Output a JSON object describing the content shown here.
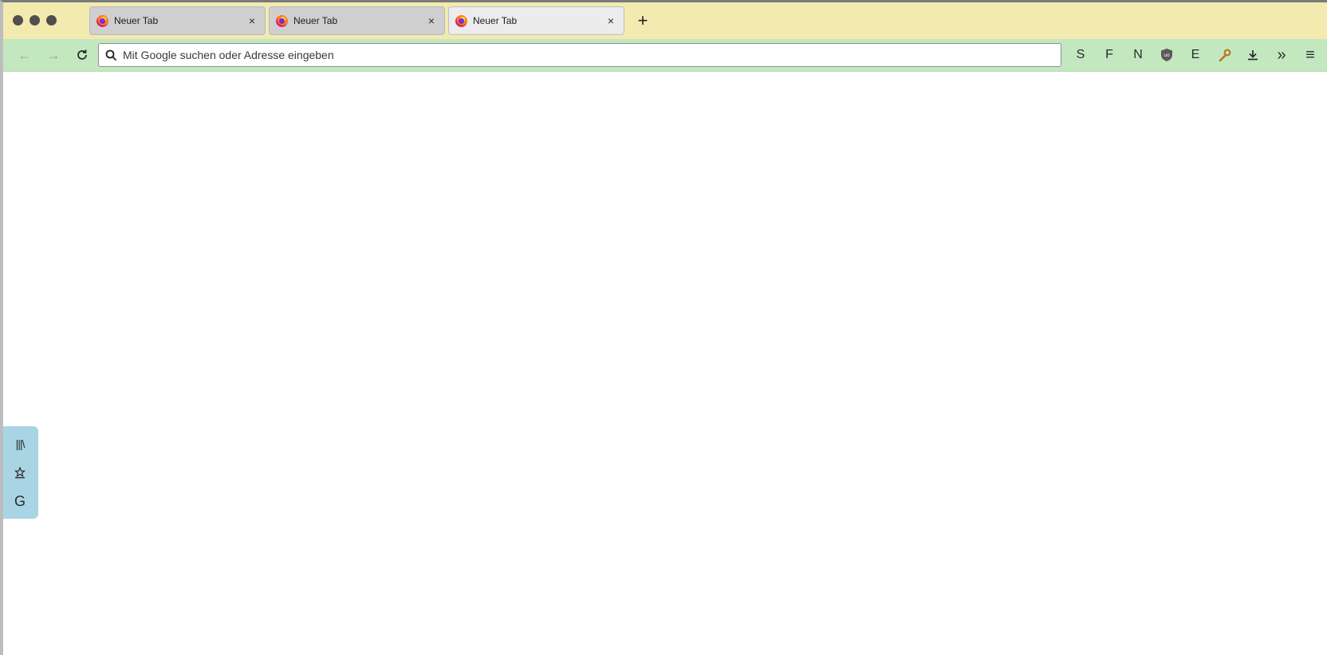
{
  "tabs": [
    {
      "label": "Neuer Tab",
      "close": "×",
      "active": false
    },
    {
      "label": "Neuer Tab",
      "close": "×",
      "active": false
    },
    {
      "label": "Neuer Tab",
      "close": "×",
      "active": true
    }
  ],
  "new_tab_symbol": "+",
  "urlbar": {
    "placeholder": "Mit Google suchen oder Adresse eingeben",
    "value": ""
  },
  "toolbar": {
    "back_symbol": "←",
    "forward_symbol": "→",
    "ext_s": "S",
    "ext_f": "F",
    "ext_n": "N",
    "ext_e": "E",
    "overflow_symbol": "»",
    "menu_symbol": "≡"
  },
  "sidebar": {
    "library_symbol": "|||\\",
    "g_label": "G"
  },
  "colors": {
    "tabstrip_bg": "#f3eab0",
    "navbar_bg": "#c3e8c0",
    "sidebar_bg": "#a9d4e4"
  }
}
